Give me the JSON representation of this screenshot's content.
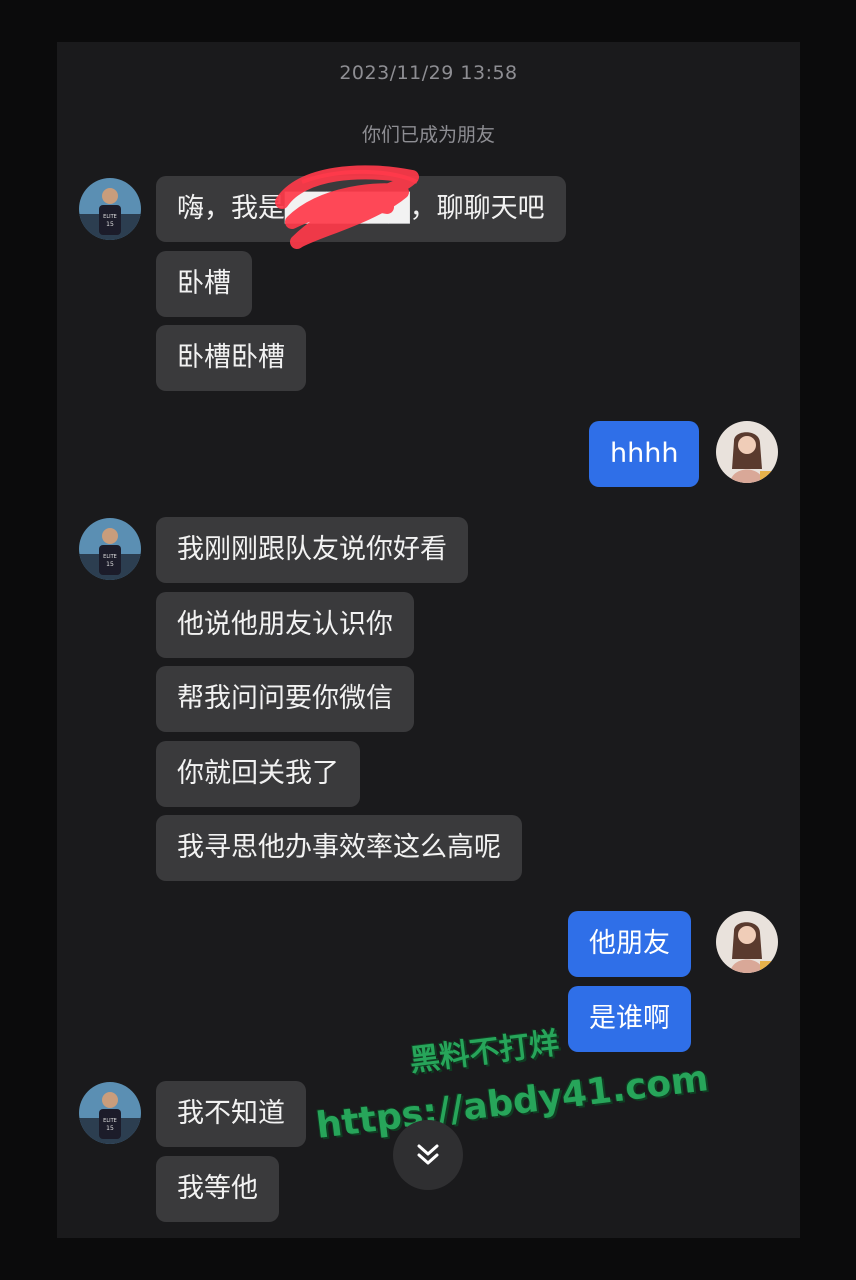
{
  "chat": {
    "timestamp": "2023/11/29 13:58",
    "system_notice": "你们已成为朋友",
    "messages": {
      "m1": {
        "sender": "other",
        "text": "嗨，我是██████，聊聊天吧"
      },
      "m2": {
        "sender": "other",
        "text": "卧槽"
      },
      "m3": {
        "sender": "other",
        "text": "卧槽卧槽"
      },
      "m4": {
        "sender": "self",
        "text": "hhhh"
      },
      "m5": {
        "sender": "other",
        "text": "我刚刚跟队友说你好看"
      },
      "m6": {
        "sender": "other",
        "text": "他说他朋友认识你"
      },
      "m7": {
        "sender": "other",
        "text": "帮我问问要你微信"
      },
      "m8": {
        "sender": "other",
        "text": "你就回关我了"
      },
      "m9": {
        "sender": "other",
        "text": "我寻思他办事效率这么高呢"
      },
      "m10": {
        "sender": "self",
        "text": "他朋友"
      },
      "m11": {
        "sender": "self",
        "text": "是谁啊"
      },
      "m12": {
        "sender": "other",
        "text": "我不知道"
      },
      "m13": {
        "sender": "other",
        "text": "我等他"
      }
    }
  },
  "watermark": {
    "line1": "黑料不打烊",
    "line2": "https://abdy41.com"
  },
  "icons": {
    "scroll_down": "chevron-double-down-icon",
    "other_avatar": "basketball-player-avatar",
    "self_avatar": "woman-avatar"
  },
  "colors": {
    "outgoing_bubble": "#2f6fe8",
    "incoming_bubble": "#3a3a3c",
    "background": "#1a1a1c"
  }
}
